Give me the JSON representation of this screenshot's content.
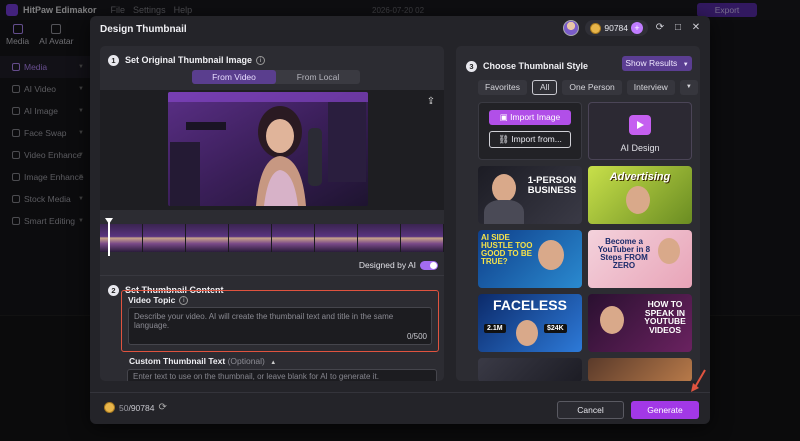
{
  "app": {
    "name": "HitPaw Edimakor",
    "menu": [
      "File",
      "Settings",
      "Help"
    ],
    "date": "2026-07-20 02",
    "export_label": "Export"
  },
  "sidebar": {
    "top_tabs": [
      {
        "label": "Media"
      },
      {
        "label": "AI Avatar"
      }
    ],
    "items": [
      {
        "label": "Media"
      },
      {
        "label": "AI Video"
      },
      {
        "label": "AI Image"
      },
      {
        "label": "Face Swap"
      },
      {
        "label": "Video Enhance"
      },
      {
        "label": "Image Enhance"
      },
      {
        "label": "Stock Media"
      },
      {
        "label": "Smart Editing"
      }
    ]
  },
  "modal": {
    "title": "Design Thumbnail",
    "credits": "90784",
    "section1": {
      "number": "1",
      "title": "Set Original Thumbnail Image",
      "tabs": [
        "From Video",
        "From Local"
      ],
      "designed_by": "Designed by AI"
    },
    "section2": {
      "number": "2",
      "title": "Set Thumbnail Content",
      "topic_label": "Video Topic",
      "topic_placeholder": "Describe your video. AI will create the thumbnail text and title in the same language.",
      "topic_counter": "0/500",
      "custom_label": "Custom Thumbnail Text",
      "custom_optional": "(Optional)",
      "custom_placeholder": "Enter text to use on the thumbnail, or leave blank for AI to generate it."
    },
    "section3": {
      "number": "3",
      "title": "Choose Thumbnail Style",
      "show_results": "Show Results",
      "filters": [
        "Favorites",
        "All",
        "One Person",
        "Interview"
      ],
      "import_image": "Import Image",
      "import_from": "Import from...",
      "ai_design": "AI Design",
      "thumbnails": [
        {
          "text": "1-PERSON BUSINESS"
        },
        {
          "text": "Advertising"
        },
        {
          "text": "AI SIDE HUSTLE TOO GOOD TO BE TRUE?"
        },
        {
          "text": "Become a YouTuber in 8 Steps FROM ZERO"
        },
        {
          "text": "FACELESS",
          "sub1": "2.1M",
          "sub2": "$24K"
        },
        {
          "text": "HOW TO SPEAK IN YOUTUBE VIDEOS"
        }
      ]
    },
    "footer": {
      "used": "50",
      "total": "/90784",
      "cancel": "Cancel",
      "generate": "Generate"
    }
  },
  "colors": {
    "accent": "#a238e6",
    "highlight_border": "#e0533f"
  }
}
